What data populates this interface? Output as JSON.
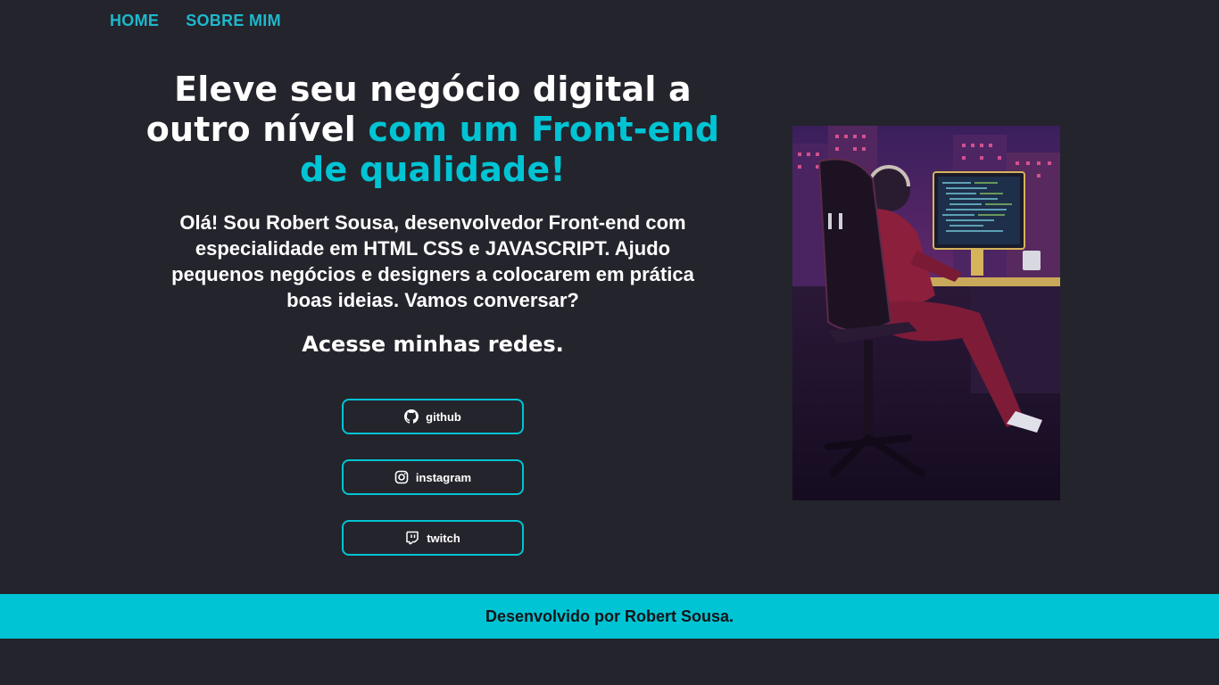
{
  "nav": {
    "items": [
      {
        "label": "HOME"
      },
      {
        "label": "SOBRE MIM"
      }
    ]
  },
  "hero": {
    "headline_plain": "Eleve seu negócio digital a outro nível",
    "headline_accent": "com um Front-end de qualidade!",
    "intro": "Olá! Sou Robert Sousa, desenvolvedor Front-end com especialidade em HTML CSS e JAVASCRIPT. Ajudo pequenos negócios e designers a colocarem em prática boas ideias. Vamos conversar?",
    "networks_title": "Acesse minhas redes."
  },
  "social": [
    {
      "label": "github",
      "icon": "github-icon"
    },
    {
      "label": "instagram",
      "icon": "instagram-icon"
    },
    {
      "label": "twitch",
      "icon": "twitch-icon"
    }
  ],
  "footer": {
    "text": "Desenvolvido por Robert Sousa."
  },
  "colors": {
    "background": "#24242c",
    "accent": "#00c4d4",
    "text": "#ffffff"
  }
}
